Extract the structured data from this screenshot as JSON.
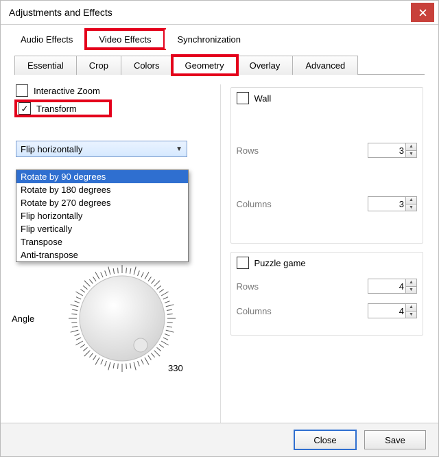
{
  "window": {
    "title": "Adjustments and Effects"
  },
  "outerTabs": {
    "audio": "Audio Effects",
    "video": "Video Effects",
    "sync": "Synchronization",
    "active": "video"
  },
  "innerTabs": {
    "essential": "Essential",
    "crop": "Crop",
    "colors": "Colors",
    "geometry": "Geometry",
    "overlay": "Overlay",
    "advanced": "Advanced",
    "active": "geometry"
  },
  "interactiveZoom": {
    "label": "Interactive Zoom",
    "checked": false
  },
  "transform": {
    "label": "Transform",
    "checked": true,
    "selected": "Flip horizontally",
    "options": [
      "Rotate by 90 degrees",
      "Rotate by 180 degrees",
      "Rotate by 270 degrees",
      "Flip horizontally",
      "Flip vertically",
      "Transpose",
      "Anti-transpose"
    ],
    "highlightedIndex": 0
  },
  "angle": {
    "label": "Angle",
    "tick330": "330"
  },
  "wall": {
    "label": "Wall",
    "checked": false,
    "rowsLabel": "Rows",
    "rows": 3,
    "colsLabel": "Columns",
    "cols": 3
  },
  "puzzle": {
    "label": "Puzzle game",
    "checked": false,
    "rowsLabel": "Rows",
    "rows": 4,
    "colsLabel": "Columns",
    "cols": 4
  },
  "footer": {
    "close": "Close",
    "save": "Save"
  },
  "colors": {
    "highlight": "#e4001b",
    "selection": "#2f6fd0",
    "closeBtn": "#c8413b"
  }
}
